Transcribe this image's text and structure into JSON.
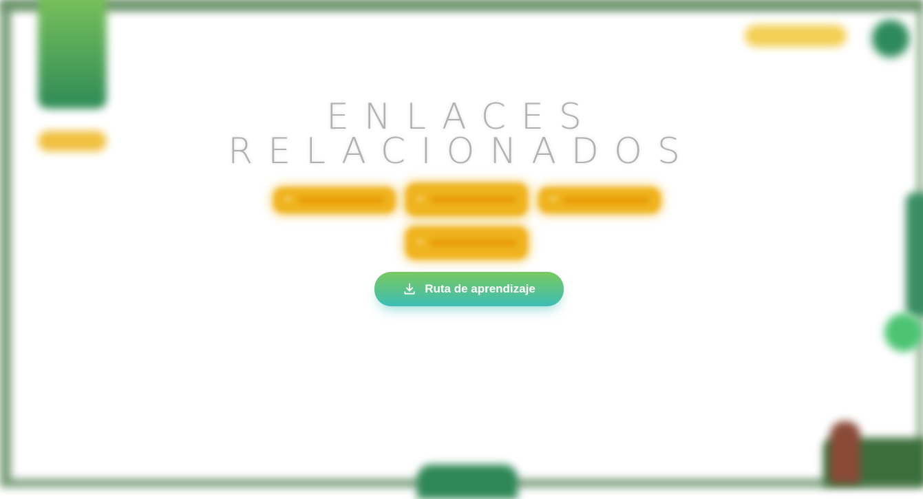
{
  "heading": {
    "line1": "ENLACES",
    "line2": "RELACIONADOS"
  },
  "links": [
    {
      "label": "",
      "icon": "login-arrow-icon"
    },
    {
      "label": "",
      "icon": "login-arrow-icon"
    },
    {
      "label": "",
      "icon": "login-arrow-icon"
    },
    {
      "label": "",
      "icon": "login-arrow-icon"
    }
  ],
  "route_button": {
    "label": "Ruta de aprendizaje",
    "icon": "download-icon"
  },
  "colors": {
    "link_bg": "#efb31d",
    "route_gradient_start": "#78c95f",
    "route_gradient_end": "#3ebdb5",
    "accent_green": "#2e8b57",
    "accent_yellow": "#f0c040"
  }
}
